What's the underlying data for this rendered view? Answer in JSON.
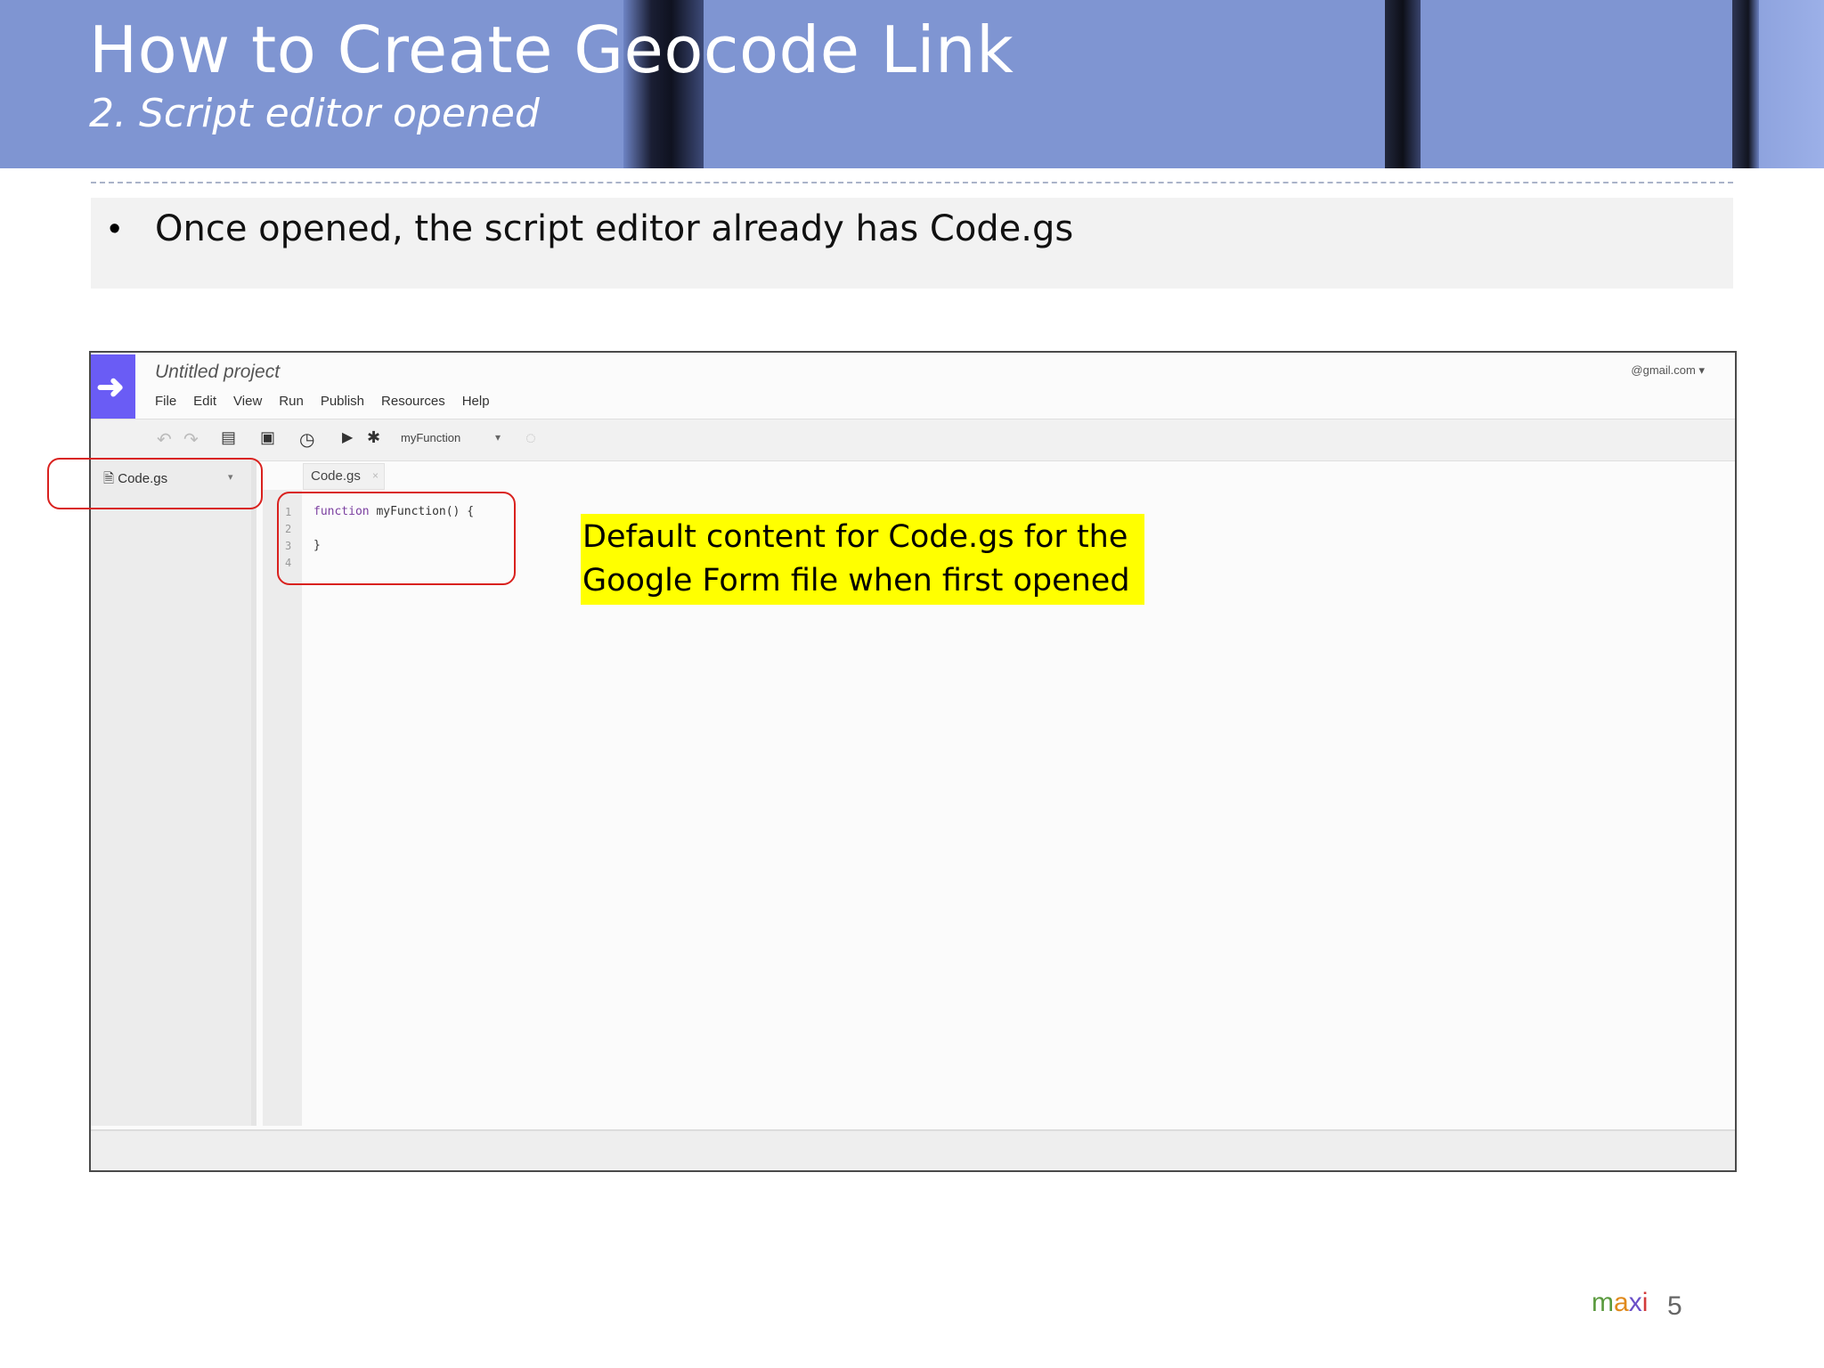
{
  "slide": {
    "title": "How to Create Geocode Link",
    "subtitle": "2. Script editor opened",
    "bullet": "Once opened, the script editor already has Code.gs",
    "callout_line1": "Default content for Code.gs for the",
    "callout_line2": "Google Form file when first opened",
    "brand": {
      "m": "m",
      "a": "a",
      "x": "x",
      "i": "i"
    },
    "page_number": "5"
  },
  "editor": {
    "project_title": "Untitled project",
    "menu": [
      "File",
      "Edit",
      "View",
      "Run",
      "Publish",
      "Resources",
      "Help"
    ],
    "account": "@gmail.com",
    "function_select": "myFunction",
    "sidebar_file": "Code.gs",
    "tab_label": "Code.gs",
    "line_numbers": [
      "1",
      "2",
      "3",
      "4"
    ],
    "code": {
      "line1_keyword": "function",
      "line1_rest": " myFunction() {",
      "line3": "}"
    }
  },
  "colors": {
    "header_blue": "#7f95d2",
    "highlight": "#ffff00",
    "annotation_red": "#d9211e",
    "apps_script_logo": "#6a5cf5"
  }
}
